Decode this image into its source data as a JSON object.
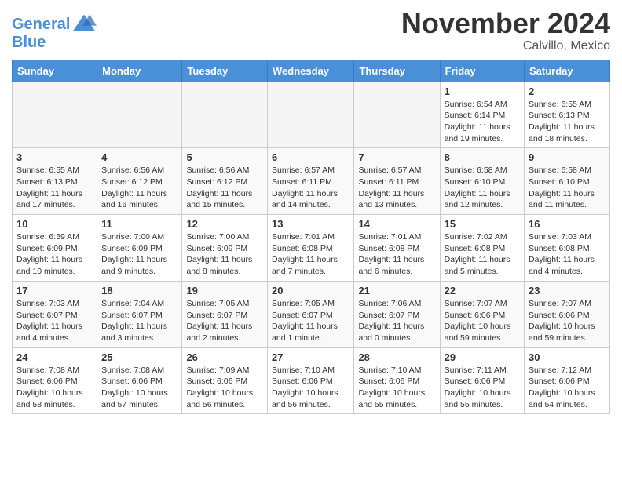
{
  "header": {
    "logo_line1": "General",
    "logo_line2": "Blue",
    "month": "November 2024",
    "location": "Calvillo, Mexico"
  },
  "days_of_week": [
    "Sunday",
    "Monday",
    "Tuesday",
    "Wednesday",
    "Thursday",
    "Friday",
    "Saturday"
  ],
  "weeks": [
    [
      {
        "day": "",
        "empty": true
      },
      {
        "day": "",
        "empty": true
      },
      {
        "day": "",
        "empty": true
      },
      {
        "day": "",
        "empty": true
      },
      {
        "day": "",
        "empty": true
      },
      {
        "day": "1",
        "sunrise": "6:54 AM",
        "sunset": "6:14 PM",
        "daylight": "11 hours and 19 minutes."
      },
      {
        "day": "2",
        "sunrise": "6:55 AM",
        "sunset": "6:13 PM",
        "daylight": "11 hours and 18 minutes."
      }
    ],
    [
      {
        "day": "3",
        "sunrise": "6:55 AM",
        "sunset": "6:13 PM",
        "daylight": "11 hours and 17 minutes."
      },
      {
        "day": "4",
        "sunrise": "6:56 AM",
        "sunset": "6:12 PM",
        "daylight": "11 hours and 16 minutes."
      },
      {
        "day": "5",
        "sunrise": "6:56 AM",
        "sunset": "6:12 PM",
        "daylight": "11 hours and 15 minutes."
      },
      {
        "day": "6",
        "sunrise": "6:57 AM",
        "sunset": "6:11 PM",
        "daylight": "11 hours and 14 minutes."
      },
      {
        "day": "7",
        "sunrise": "6:57 AM",
        "sunset": "6:11 PM",
        "daylight": "11 hours and 13 minutes."
      },
      {
        "day": "8",
        "sunrise": "6:58 AM",
        "sunset": "6:10 PM",
        "daylight": "11 hours and 12 minutes."
      },
      {
        "day": "9",
        "sunrise": "6:58 AM",
        "sunset": "6:10 PM",
        "daylight": "11 hours and 11 minutes."
      }
    ],
    [
      {
        "day": "10",
        "sunrise": "6:59 AM",
        "sunset": "6:09 PM",
        "daylight": "11 hours and 10 minutes."
      },
      {
        "day": "11",
        "sunrise": "7:00 AM",
        "sunset": "6:09 PM",
        "daylight": "11 hours and 9 minutes."
      },
      {
        "day": "12",
        "sunrise": "7:00 AM",
        "sunset": "6:09 PM",
        "daylight": "11 hours and 8 minutes."
      },
      {
        "day": "13",
        "sunrise": "7:01 AM",
        "sunset": "6:08 PM",
        "daylight": "11 hours and 7 minutes."
      },
      {
        "day": "14",
        "sunrise": "7:01 AM",
        "sunset": "6:08 PM",
        "daylight": "11 hours and 6 minutes."
      },
      {
        "day": "15",
        "sunrise": "7:02 AM",
        "sunset": "6:08 PM",
        "daylight": "11 hours and 5 minutes."
      },
      {
        "day": "16",
        "sunrise": "7:03 AM",
        "sunset": "6:08 PM",
        "daylight": "11 hours and 4 minutes."
      }
    ],
    [
      {
        "day": "17",
        "sunrise": "7:03 AM",
        "sunset": "6:07 PM",
        "daylight": "11 hours and 4 minutes."
      },
      {
        "day": "18",
        "sunrise": "7:04 AM",
        "sunset": "6:07 PM",
        "daylight": "11 hours and 3 minutes."
      },
      {
        "day": "19",
        "sunrise": "7:05 AM",
        "sunset": "6:07 PM",
        "daylight": "11 hours and 2 minutes."
      },
      {
        "day": "20",
        "sunrise": "7:05 AM",
        "sunset": "6:07 PM",
        "daylight": "11 hours and 1 minute."
      },
      {
        "day": "21",
        "sunrise": "7:06 AM",
        "sunset": "6:07 PM",
        "daylight": "11 hours and 0 minutes."
      },
      {
        "day": "22",
        "sunrise": "7:07 AM",
        "sunset": "6:06 PM",
        "daylight": "10 hours and 59 minutes."
      },
      {
        "day": "23",
        "sunrise": "7:07 AM",
        "sunset": "6:06 PM",
        "daylight": "10 hours and 59 minutes."
      }
    ],
    [
      {
        "day": "24",
        "sunrise": "7:08 AM",
        "sunset": "6:06 PM",
        "daylight": "10 hours and 58 minutes."
      },
      {
        "day": "25",
        "sunrise": "7:08 AM",
        "sunset": "6:06 PM",
        "daylight": "10 hours and 57 minutes."
      },
      {
        "day": "26",
        "sunrise": "7:09 AM",
        "sunset": "6:06 PM",
        "daylight": "10 hours and 56 minutes."
      },
      {
        "day": "27",
        "sunrise": "7:10 AM",
        "sunset": "6:06 PM",
        "daylight": "10 hours and 56 minutes."
      },
      {
        "day": "28",
        "sunrise": "7:10 AM",
        "sunset": "6:06 PM",
        "daylight": "10 hours and 55 minutes."
      },
      {
        "day": "29",
        "sunrise": "7:11 AM",
        "sunset": "6:06 PM",
        "daylight": "10 hours and 55 minutes."
      },
      {
        "day": "30",
        "sunrise": "7:12 AM",
        "sunset": "6:06 PM",
        "daylight": "10 hours and 54 minutes."
      }
    ]
  ]
}
